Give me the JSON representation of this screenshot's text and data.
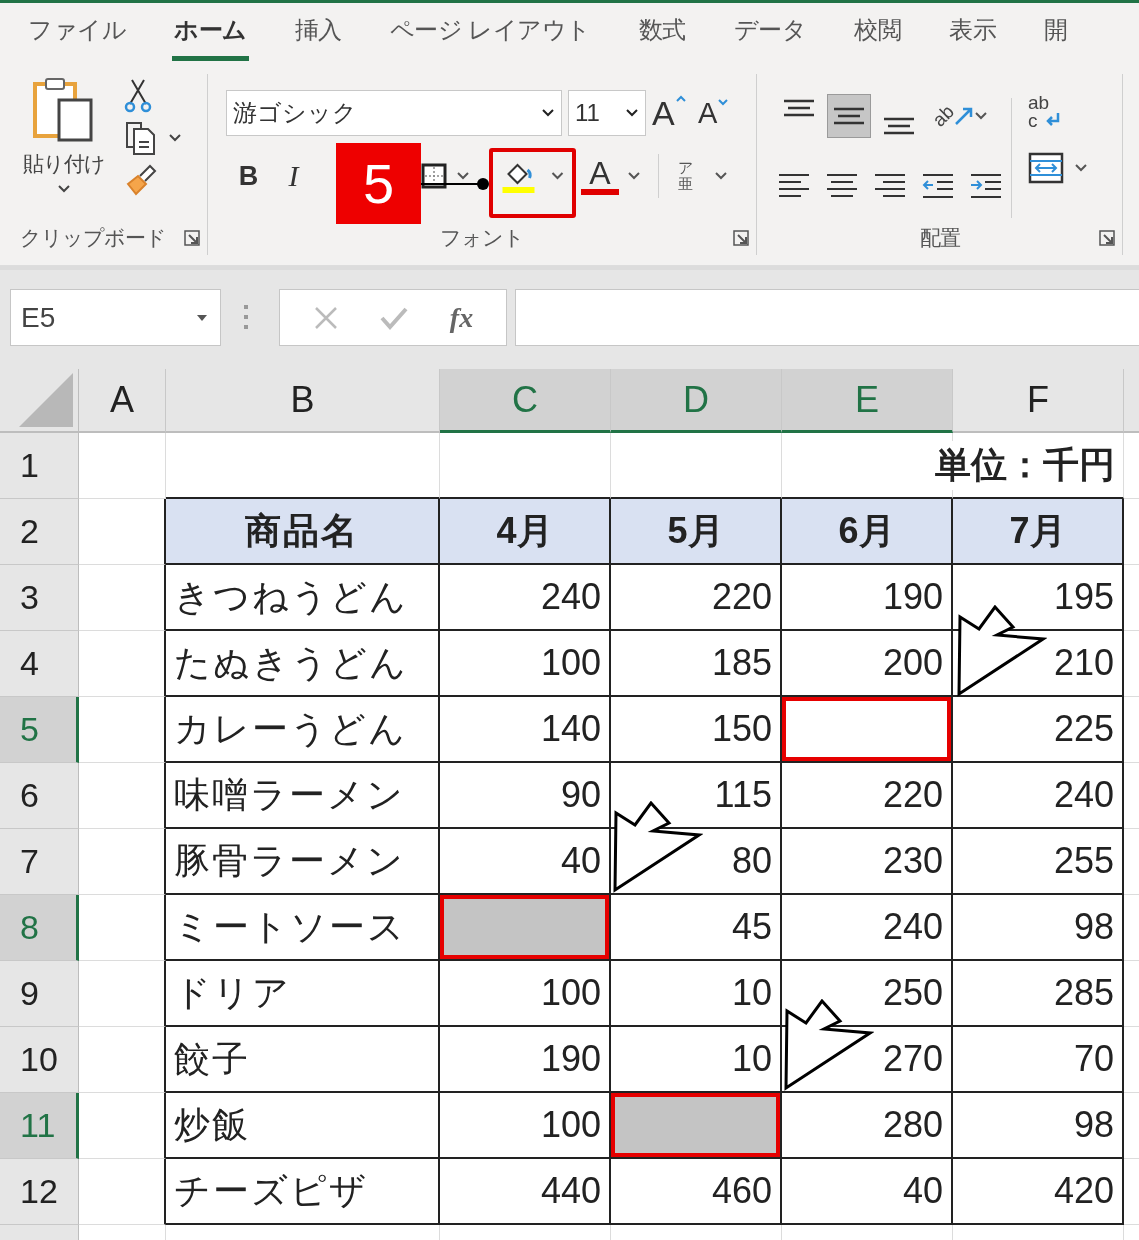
{
  "ribbon_tabs": [
    {
      "label": "ファイル",
      "selected": false
    },
    {
      "label": "ホーム",
      "selected": true
    },
    {
      "label": "挿入",
      "selected": false
    },
    {
      "label": "ページ レイアウト",
      "selected": false
    },
    {
      "label": "数式",
      "selected": false
    },
    {
      "label": "データ",
      "selected": false
    },
    {
      "label": "校閲",
      "selected": false
    },
    {
      "label": "表示",
      "selected": false
    },
    {
      "label": "開",
      "selected": false
    }
  ],
  "clipboard": {
    "paste_label": "貼り付け",
    "group_label": "クリップボード"
  },
  "font": {
    "name": "游ゴシック",
    "size": "11",
    "grow": "A",
    "shrink": "A",
    "bold": "B",
    "italic": "I",
    "font_color": "A",
    "furigana_top": "ア",
    "furigana_bottom": "亜",
    "group_label": "フォント"
  },
  "callout": {
    "step": "5"
  },
  "alignment": {
    "vertical": [
      {
        "kind": "top",
        "selected": false
      },
      {
        "kind": "middle",
        "selected": true
      },
      {
        "kind": "bottom",
        "selected": false
      }
    ],
    "orientation": "ab",
    "horizontal": [
      {
        "kind": "left"
      },
      {
        "kind": "center"
      },
      {
        "kind": "right"
      },
      {
        "kind": "outdent"
      },
      {
        "kind": "indent"
      }
    ],
    "wrap_top": "ab",
    "wrap_bottom": "c",
    "group_label": "配置"
  },
  "name_box": "E5",
  "formula_fx": "fx",
  "columns": [
    {
      "label": "A",
      "selected": false
    },
    {
      "label": "B",
      "selected": false
    },
    {
      "label": "C",
      "selected": true
    },
    {
      "label": "D",
      "selected": true
    },
    {
      "label": "E",
      "selected": true
    },
    {
      "label": "F",
      "selected": false
    }
  ],
  "rows": [
    {
      "kind": "title",
      "number": "1",
      "selected": false,
      "note": "単位：千円"
    },
    {
      "kind": "header",
      "number": "2",
      "selected": false,
      "cells": [
        {
          "text": "商品名",
          "selected": false,
          "filled": false
        },
        {
          "text": "4月",
          "selected": false,
          "filled": false
        },
        {
          "text": "5月",
          "selected": false,
          "filled": false
        },
        {
          "text": "6月",
          "selected": false,
          "filled": false
        },
        {
          "text": "7月",
          "selected": false,
          "filled": false
        }
      ]
    },
    {
      "kind": "data",
      "number": "3",
      "selected": false,
      "cells": [
        {
          "text": "きつねうどん",
          "selected": false,
          "filled": false
        },
        {
          "text": "240",
          "selected": false,
          "filled": false
        },
        {
          "text": "220",
          "selected": false,
          "filled": false
        },
        {
          "text": "190",
          "selected": false,
          "filled": false
        },
        {
          "text": "195",
          "selected": false,
          "filled": false
        }
      ]
    },
    {
      "kind": "data",
      "number": "4",
      "selected": false,
      "cells": [
        {
          "text": "たぬきうどん",
          "selected": false,
          "filled": false
        },
        {
          "text": "100",
          "selected": false,
          "filled": false
        },
        {
          "text": "185",
          "selected": false,
          "filled": false
        },
        {
          "text": "200",
          "selected": false,
          "filled": false
        },
        {
          "text": "210",
          "selected": false,
          "filled": false
        }
      ]
    },
    {
      "kind": "data",
      "number": "5",
      "selected": true,
      "cells": [
        {
          "text": "カレーうどん",
          "selected": false,
          "filled": false
        },
        {
          "text": "140",
          "selected": false,
          "filled": false
        },
        {
          "text": "150",
          "selected": false,
          "filled": false
        },
        {
          "text": "",
          "selected": true,
          "filled": false
        },
        {
          "text": "225",
          "selected": false,
          "filled": false
        }
      ]
    },
    {
      "kind": "data",
      "number": "6",
      "selected": false,
      "cells": [
        {
          "text": "味噌ラーメン",
          "selected": false,
          "filled": false
        },
        {
          "text": "90",
          "selected": false,
          "filled": false
        },
        {
          "text": "115",
          "selected": false,
          "filled": false
        },
        {
          "text": "220",
          "selected": false,
          "filled": false
        },
        {
          "text": "240",
          "selected": false,
          "filled": false
        }
      ]
    },
    {
      "kind": "data",
      "number": "7",
      "selected": false,
      "cells": [
        {
          "text": "豚骨ラーメン",
          "selected": false,
          "filled": false
        },
        {
          "text": "40",
          "selected": false,
          "filled": false
        },
        {
          "text": "80",
          "selected": false,
          "filled": false
        },
        {
          "text": "230",
          "selected": false,
          "filled": false
        },
        {
          "text": "255",
          "selected": false,
          "filled": false
        }
      ]
    },
    {
      "kind": "data",
      "number": "8",
      "selected": true,
      "cells": [
        {
          "text": "ミートソース",
          "selected": false,
          "filled": false
        },
        {
          "text": "",
          "selected": true,
          "filled": true
        },
        {
          "text": "45",
          "selected": false,
          "filled": false
        },
        {
          "text": "240",
          "selected": false,
          "filled": false
        },
        {
          "text": "98",
          "selected": false,
          "filled": false
        }
      ]
    },
    {
      "kind": "data",
      "number": "9",
      "selected": false,
      "cells": [
        {
          "text": "ドリア",
          "selected": false,
          "filled": false
        },
        {
          "text": "100",
          "selected": false,
          "filled": false
        },
        {
          "text": "10",
          "selected": false,
          "filled": false
        },
        {
          "text": "250",
          "selected": false,
          "filled": false
        },
        {
          "text": "285",
          "selected": false,
          "filled": false
        }
      ]
    },
    {
      "kind": "data",
      "number": "10",
      "selected": false,
      "cells": [
        {
          "text": "餃子",
          "selected": false,
          "filled": false
        },
        {
          "text": "190",
          "selected": false,
          "filled": false
        },
        {
          "text": "10",
          "selected": false,
          "filled": false
        },
        {
          "text": "270",
          "selected": false,
          "filled": false
        },
        {
          "text": "70",
          "selected": false,
          "filled": false
        }
      ]
    },
    {
      "kind": "data",
      "number": "11",
      "selected": true,
      "cells": [
        {
          "text": "炒飯",
          "selected": false,
          "filled": false
        },
        {
          "text": "100",
          "selected": false,
          "filled": false
        },
        {
          "text": "",
          "selected": true,
          "filled": true
        },
        {
          "text": "280",
          "selected": false,
          "filled": false
        },
        {
          "text": "98",
          "selected": false,
          "filled": false
        }
      ]
    },
    {
      "kind": "data",
      "number": "12",
      "selected": false,
      "cells": [
        {
          "text": "チーズピザ",
          "selected": false,
          "filled": false
        },
        {
          "text": "440",
          "selected": false,
          "filled": false
        },
        {
          "text": "460",
          "selected": false,
          "filled": false
        },
        {
          "text": "40",
          "selected": false,
          "filled": false
        },
        {
          "text": "420",
          "selected": false,
          "filled": false
        }
      ]
    },
    {
      "kind": "partial"
    }
  ]
}
